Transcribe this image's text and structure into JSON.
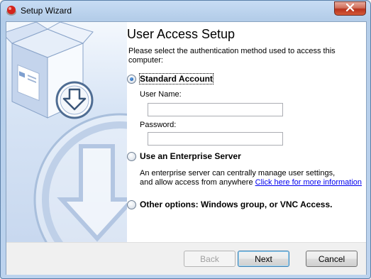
{
  "window": {
    "title": "Setup Wizard",
    "icon": "setup-app-icon",
    "close_icon": "close-icon"
  },
  "page": {
    "heading": "User Access Setup",
    "instructions": "Please select the authentication method used to access this computer:"
  },
  "options": {
    "standard": {
      "label": "Standard Account",
      "selected": true,
      "username_label": "User Name:",
      "username_value": "",
      "password_label": "Password:",
      "password_value": ""
    },
    "enterprise": {
      "label": "Use an Enterprise Server",
      "selected": false,
      "desc_line1": "An enterprise server can centrally manage user settings,",
      "desc_line2": "and allow access from anywhere",
      "link": "Click here for more information"
    },
    "other": {
      "label": "Other options: Windows group, or VNC Access.",
      "selected": false
    }
  },
  "buttons": {
    "back": "Back",
    "next": "Next",
    "cancel": "Cancel"
  },
  "colors": {
    "link": "#0000ee",
    "titlebar": "#c7dcf4",
    "close": "#c7402a"
  }
}
